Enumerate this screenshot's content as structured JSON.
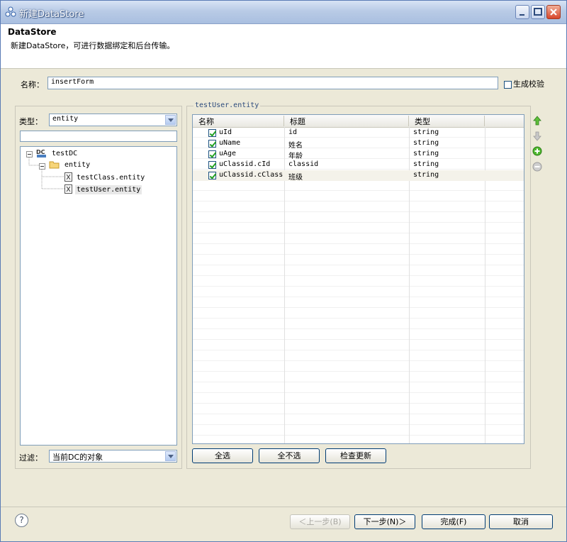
{
  "window": {
    "title": "新建DataStore"
  },
  "header": {
    "title": "DataStore",
    "description": "新建DataStore，可进行数据绑定和后台传输。"
  },
  "name_field": {
    "label": "名称：",
    "value": "insertForm"
  },
  "verify": {
    "label": "生成校验",
    "checked": false
  },
  "left": {
    "type_label": "类型：",
    "type_value": "entity",
    "tree": {
      "root": "testDC",
      "folder": "entity",
      "items": [
        "testClass.entity",
        "testUser.entity"
      ]
    },
    "filter_label": "过滤：",
    "filter_value": "当前DC的对象"
  },
  "right": {
    "group_label": "testUser.entity",
    "columns": [
      "名称",
      "标题",
      "类型"
    ],
    "rows": [
      {
        "name": "uId",
        "title": "id",
        "type": "string"
      },
      {
        "name": "uName",
        "title": "姓名",
        "type": "string"
      },
      {
        "name": "uAge",
        "title": "年龄",
        "type": "string"
      },
      {
        "name": "uClassid.cId",
        "title": "classid",
        "type": "string"
      },
      {
        "name": "uClassid.cClass",
        "title": "班级",
        "type": "string"
      }
    ],
    "buttons": {
      "select_all": "全选",
      "select_none": "全不选",
      "check_update": "检查更新"
    },
    "side_icons": [
      "arrow-up-icon",
      "arrow-down-icon",
      "add-icon",
      "remove-icon"
    ]
  },
  "footer": {
    "help": "?",
    "back": "＜上一步(B)",
    "next": "下一步(N)＞",
    "finish": "完成(F)",
    "cancel": "取消"
  }
}
